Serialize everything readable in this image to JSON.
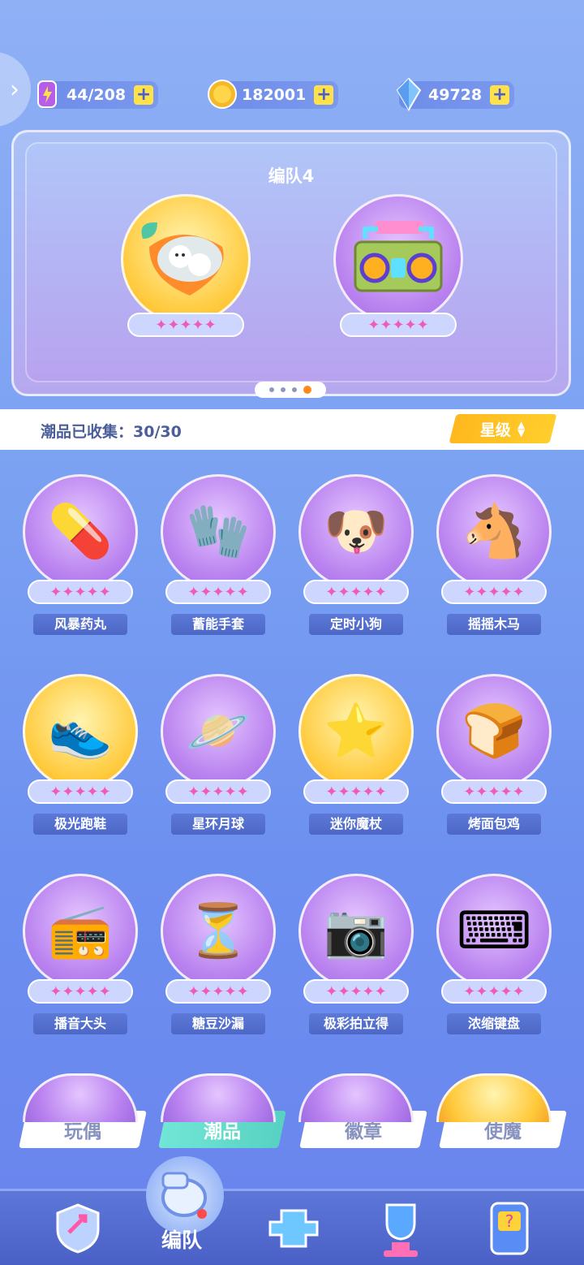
{
  "resources": [
    {
      "value": "44/208",
      "icon": "energy-battery-icon"
    },
    {
      "value": "182001",
      "icon": "gold-coin-icon"
    },
    {
      "value": "49728",
      "icon": "crystal-gem-icon"
    }
  ],
  "team": {
    "title": "编队4",
    "slots": [
      {
        "icon": "bunny-carrot-capsule",
        "stars": "✦✦✦✦✦"
      },
      {
        "icon": "boombox-radio",
        "stars": "✦✦✦✦✦"
      }
    ],
    "page_dots": 4,
    "active_page": 4
  },
  "collection": {
    "label": "潮品已收集：30/30",
    "sort_label": "星级"
  },
  "items": [
    {
      "name": "风暴药丸",
      "stars": "✦✦✦✦✦",
      "icon": "💊"
    },
    {
      "name": "蓄能手套",
      "stars": "✦✦✦✦✦",
      "icon": "🧤"
    },
    {
      "name": "定时小狗",
      "stars": "✦✦✦✦✦",
      "icon": "🐶"
    },
    {
      "name": "摇摇木马",
      "stars": "✦✦✦✦✦",
      "icon": "🐴"
    },
    {
      "name": "极光跑鞋",
      "stars": "✦✦✦✦✦",
      "icon": "👟"
    },
    {
      "name": "星环月球",
      "stars": "✦✦✦✦✦",
      "icon": "🪐"
    },
    {
      "name": "迷你魔杖",
      "stars": "✦✦✦✦✦",
      "icon": "⭐"
    },
    {
      "name": "烤面包鸡",
      "stars": "✦✦✦✦✦",
      "icon": "🍞"
    },
    {
      "name": "播音大头",
      "stars": "✦✦✦✦✦",
      "icon": "📻"
    },
    {
      "name": "糖豆沙漏",
      "stars": "✦✦✦✦✦",
      "icon": "⏳"
    },
    {
      "name": "极彩拍立得",
      "stars": "✦✦✦✦✦",
      "icon": "📷"
    },
    {
      "name": "浓缩键盘",
      "stars": "✦✦✦✦✦",
      "icon": "⌨"
    }
  ],
  "tabs": [
    {
      "label": "玩偶",
      "active": false
    },
    {
      "label": "潮品",
      "active": true
    },
    {
      "label": "徽章",
      "active": false
    },
    {
      "label": "使魔",
      "active": false
    }
  ],
  "bottom_nav": {
    "active_label": "编队",
    "items": [
      "shield-arrow-icon",
      "whistle-icon",
      "gamepad-icon",
      "trophy-icon",
      "mystery-machine-icon"
    ]
  },
  "colors": {
    "star": "#f05ab8",
    "accent_orange": "#ff8a1e",
    "sort_yellow": "#ffb81e",
    "tab_active": "#57d2c2"
  }
}
